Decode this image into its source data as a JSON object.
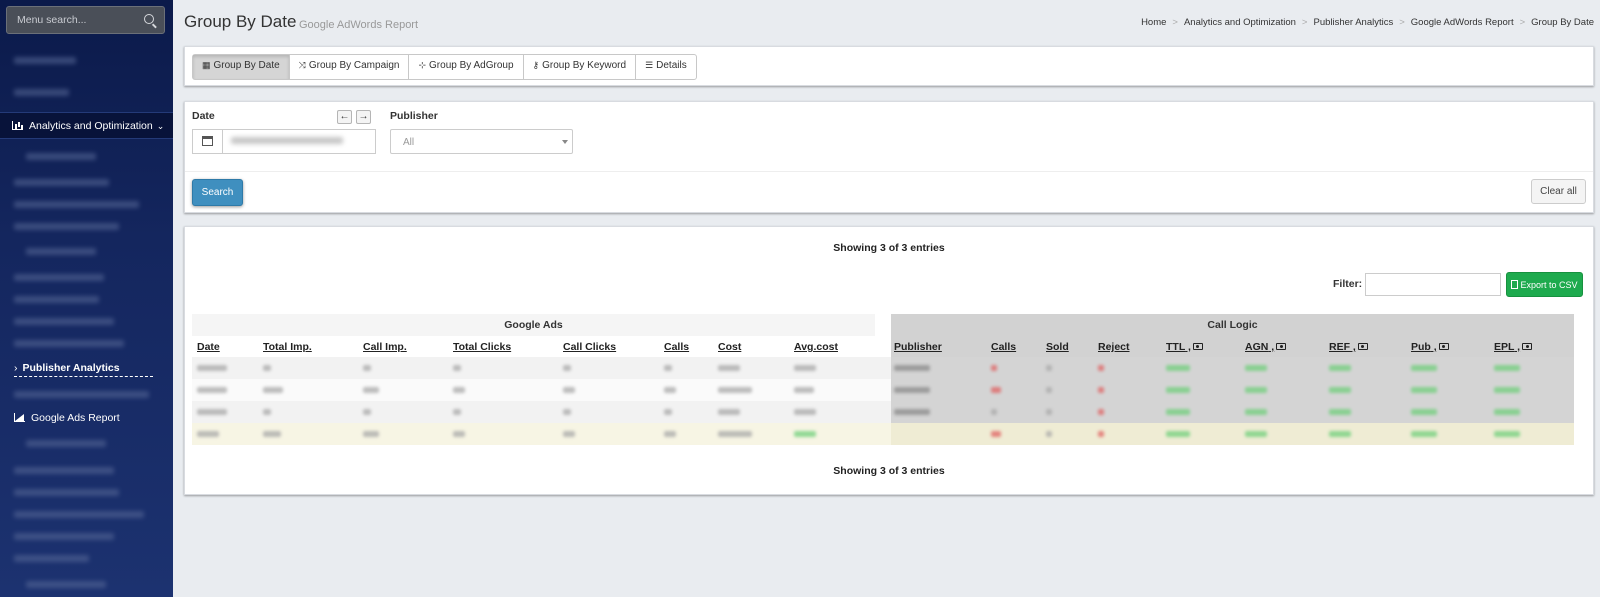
{
  "sidebar": {
    "search_placeholder": "Menu search...",
    "active_section": "Analytics and Optimization",
    "publisher_analytics": "Publisher Analytics",
    "google_ads_report": "Google Ads Report"
  },
  "header": {
    "title": "Group By Date",
    "subtitle": "Google AdWords Report",
    "breadcrumb": [
      "Home",
      "Analytics and Optimization",
      "Publisher Analytics",
      "Google AdWords Report",
      "Group By Date"
    ]
  },
  "tabs": [
    {
      "label": "Group By Date",
      "active": true
    },
    {
      "label": "Group By Campaign",
      "active": false
    },
    {
      "label": "Group By AdGroup",
      "active": false
    },
    {
      "label": "Group By Keyword",
      "active": false
    },
    {
      "label": "Details",
      "active": false
    }
  ],
  "filters": {
    "date_label": "Date",
    "publisher_label": "Publisher",
    "publisher_value": "All",
    "search_button": "Search",
    "clear_button": "Clear all"
  },
  "table": {
    "showing_top": "Showing 3 of 3 entries",
    "showing_bottom": "Showing 3 of 3 entries",
    "filter_label": "Filter:",
    "export_button": "Export to CSV",
    "group_google_ads": "Google Ads",
    "group_call_logic": "Call Logic",
    "google_ads_columns": [
      "Date",
      "Total Imp.",
      "Call Imp.",
      "Total Clicks",
      "Call Clicks",
      "Calls",
      "Cost",
      "Avg.cost"
    ],
    "call_logic_columns": [
      "Publisher",
      "Calls",
      "Sold",
      "Reject",
      "TTL",
      "AGN",
      "REF",
      "Pub",
      "EPL"
    ]
  },
  "colors": {
    "sidebar_bg": "#0b1a4a",
    "search_btn": "#3f8fbf",
    "export_btn": "#1eaa4e"
  }
}
